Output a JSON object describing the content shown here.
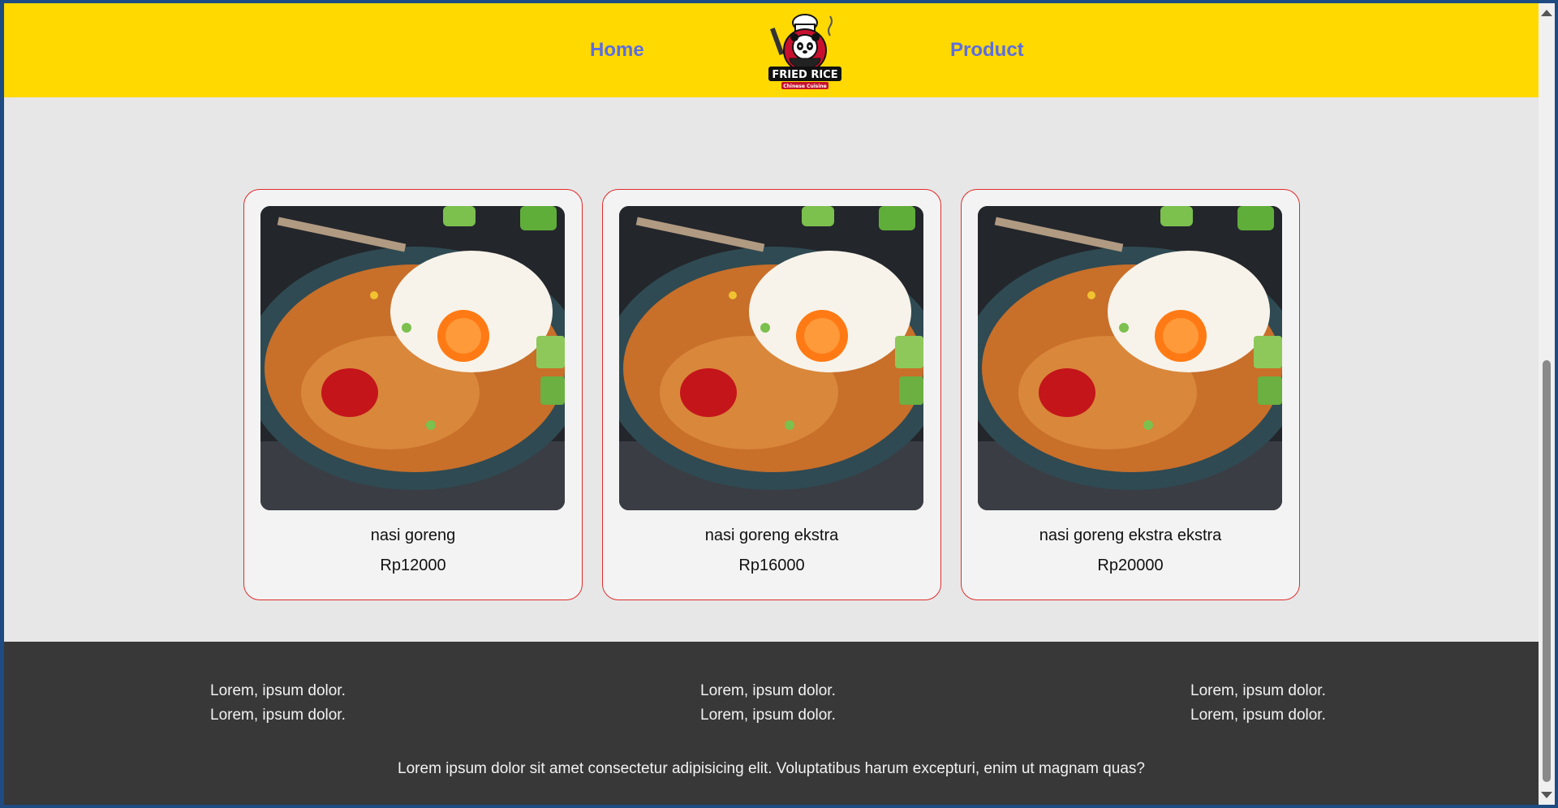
{
  "header": {
    "nav_home": "Home",
    "nav_product": "Product",
    "logo": {
      "title": "FRIED RICE",
      "subtitle": "Chinese Cuisine"
    }
  },
  "products": [
    {
      "name": "nasi goreng",
      "price": "Rp12000",
      "image": "nasi-goreng-photo"
    },
    {
      "name": "nasi goreng ekstra",
      "price": "Rp16000",
      "image": "nasi-goreng-photo"
    },
    {
      "name": "nasi goreng ekstra ekstra",
      "price": "Rp20000",
      "image": "nasi-goreng-photo"
    }
  ],
  "footer": {
    "columns": [
      {
        "line1": "Lorem, ipsum dolor.",
        "line2": "Lorem, ipsum dolor."
      },
      {
        "line1": "Lorem, ipsum dolor.",
        "line2": "Lorem, ipsum dolor."
      },
      {
        "line1": "Lorem, ipsum dolor.",
        "line2": "Lorem, ipsum dolor."
      }
    ],
    "note": "Lorem ipsum dolor sit amet consectetur adipisicing elit. Voluptatibus harum excepturi, enim ut magnam quas?"
  },
  "colors": {
    "header_bg": "#ffd900",
    "nav_link": "#5b6ee0",
    "card_border": "#e02b2b",
    "footer_bg": "#383838",
    "page_bg": "#e7e7e7"
  }
}
